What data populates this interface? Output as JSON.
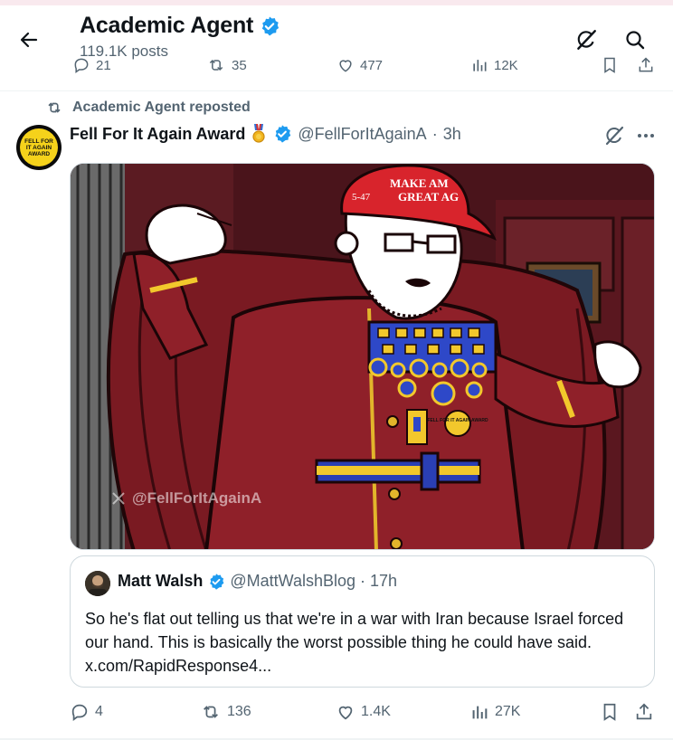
{
  "header": {
    "title": "Academic Agent",
    "subtitle": "119.1K posts",
    "back_icon": "arrow-left-icon",
    "grok_icon": "grok-icon",
    "search_icon": "search-icon"
  },
  "previous_tweet": {
    "replies": "21",
    "reposts": "35",
    "likes": "477",
    "views": "12K"
  },
  "repost": {
    "label": "Academic Agent reposted"
  },
  "tweet": {
    "author_name": "Fell For It Again Award",
    "handle": "@FellForItAgainA",
    "separator": "·",
    "time": "3h",
    "avatar_text": "FELL FOR IT AGAIN AWARD",
    "media": {
      "hat_text_line1": "MAKE AM",
      "hat_text_line2": "GREAT AG",
      "hat_side_text": "5-47",
      "watermark": "@FellForItAgainA",
      "medal_text": "FELL FOR IT AGAIN AWARD"
    },
    "quoted": {
      "author_name": "Matt Walsh",
      "handle": "@MattWalshBlog",
      "separator": "·",
      "time": "17h",
      "text": "So he's flat out telling us that we're in a war with Iran because Israel forced our hand. This is basically the worst possible thing he could have said. x.com/RapidResponse4..."
    },
    "stats": {
      "replies": "4",
      "reposts": "136",
      "likes": "1.4K",
      "views": "27K"
    }
  },
  "colors": {
    "accent_blue": "#1d9bf0",
    "secondary_text": "#536471",
    "primary_text": "#0f1419",
    "border": "#cfd9de"
  }
}
